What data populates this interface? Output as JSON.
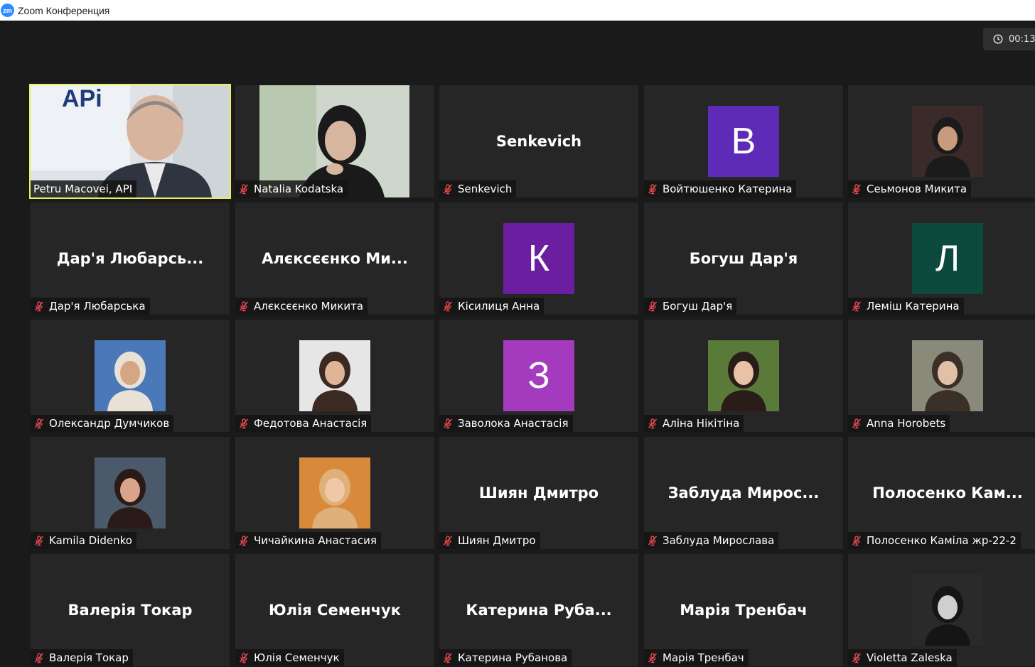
{
  "window": {
    "title": "Zoom Конференция",
    "logo_text": "zm"
  },
  "meeting": {
    "timer": "00:13"
  },
  "colors": {
    "active_speaker_border": "#e8f15a",
    "muted_icon": "#e5484d",
    "tile_bg": "#262626"
  },
  "participants": [
    {
      "name": "Petru Macovei, API",
      "display": "video",
      "muted": false,
      "active": true
    },
    {
      "name": "Natalia Kodatska",
      "display": "video",
      "muted": true
    },
    {
      "name": "Senkevich",
      "display": "name",
      "center_text": "Senkevich",
      "muted": true
    },
    {
      "name": "Войтюшенко Катерина",
      "display": "letter",
      "letter": "В",
      "color": "#5d2bb8",
      "muted": true
    },
    {
      "name": "Сеьмонов Микита",
      "display": "photo",
      "muted": true
    },
    {
      "name": "Дар'я Любарська",
      "display": "name",
      "center_text": "Дар'я Любарсь...",
      "muted": true
    },
    {
      "name": "Алєксєєнко Микита",
      "display": "name",
      "center_text": "Алєксєєнко Ми...",
      "muted": true
    },
    {
      "name": "Кісилиця Анна",
      "display": "letter",
      "letter": "К",
      "color": "#6b1fa0",
      "muted": true
    },
    {
      "name": "Богуш Дар'я",
      "display": "name",
      "center_text": "Богуш Дар'я",
      "muted": true
    },
    {
      "name": "Леміш Катерина",
      "display": "letter",
      "letter": "Л",
      "color": "#0d4a3e",
      "muted": true
    },
    {
      "name": "Олександр Думчиков",
      "display": "photo",
      "muted": true
    },
    {
      "name": "Федотова Анастасія",
      "display": "photo",
      "muted": true
    },
    {
      "name": "Заволока Анастасія",
      "display": "letter",
      "letter": "З",
      "color": "#a43bbf",
      "muted": true
    },
    {
      "name": "Аліна Нікітіна",
      "display": "photo",
      "muted": true
    },
    {
      "name": "Anna Horobets",
      "display": "photo",
      "muted": true
    },
    {
      "name": "Kamila Didenko",
      "display": "photo",
      "muted": true
    },
    {
      "name": "Чичайкина Анастасия",
      "display": "photo",
      "muted": true
    },
    {
      "name": "Шиян Дмитро",
      "display": "name",
      "center_text": "Шиян Дмитро",
      "muted": true
    },
    {
      "name": "Заблуда Мирослава",
      "display": "name",
      "center_text": "Заблуда  Мирос...",
      "muted": true
    },
    {
      "name": "Полосенко Каміла жр-22-2",
      "display": "name",
      "center_text": "Полосенко  Кам...",
      "muted": true
    },
    {
      "name": "Валерія Токар",
      "display": "name",
      "center_text": "Валерія Токар",
      "muted": true
    },
    {
      "name": "Юлія Семенчук",
      "display": "name",
      "center_text": "Юлія Семенчук",
      "muted": true
    },
    {
      "name": "Катерина Рубанова",
      "display": "name",
      "center_text": "Катерина  Руба...",
      "muted": true
    },
    {
      "name": "Марія Тренбач",
      "display": "name",
      "center_text": "Марія Тренбач",
      "muted": true
    },
    {
      "name": "Violetta Zaleska",
      "display": "photo",
      "muted": true
    }
  ]
}
